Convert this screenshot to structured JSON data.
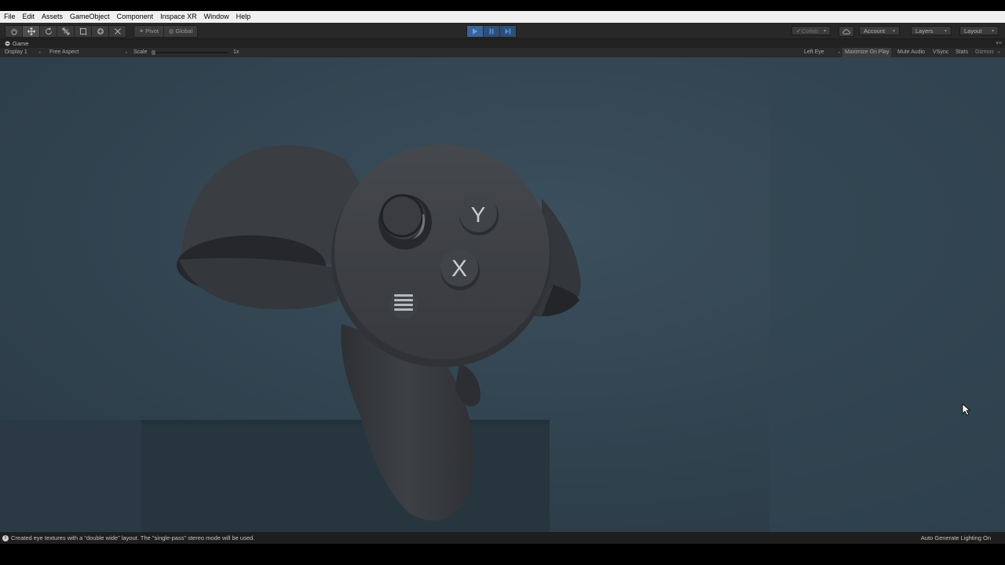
{
  "menu": [
    "File",
    "Edit",
    "Assets",
    "GameObject",
    "Component",
    "Inspace XR",
    "Window",
    "Help"
  ],
  "toolbar": {
    "transform_tools": [
      "hand-tool-icon",
      "move-tool-icon",
      "rotate-tool-icon",
      "scale-tool-icon",
      "rect-tool-icon",
      "transform-tool-icon",
      "custom-tool-icon"
    ],
    "pivot_label": "Pivot",
    "global_label": "Global",
    "play_controls": [
      "play-icon",
      "pause-icon",
      "step-icon"
    ],
    "collab_label": "Collab",
    "account_label": "Account",
    "layers_label": "Layers",
    "layout_label": "Layout"
  },
  "game_view": {
    "tab_label": "Game",
    "display_label": "Display 1",
    "aspect_label": "Free Aspect",
    "scale_label": "Scale",
    "scale_value": "1x",
    "eye_label": "Left Eye",
    "maximize_label": "Maximize On Play",
    "mute_label": "Mute Audio",
    "vsync_label": "VSync",
    "stats_label": "Stats",
    "gizmos_label": "Gizmos",
    "controller": {
      "button_y": "Y",
      "button_x": "X"
    }
  },
  "status_bar": {
    "message": "Created eye textures with a \"double wide\" layout. The \"single-pass\" stereo mode will be used.",
    "lighting": "Auto Generate Lighting On"
  },
  "colors": {
    "scene_background": "#30424e",
    "controller": "#3a3d41",
    "play_active": "#3a6396",
    "menubar": "#f0f0f0"
  }
}
